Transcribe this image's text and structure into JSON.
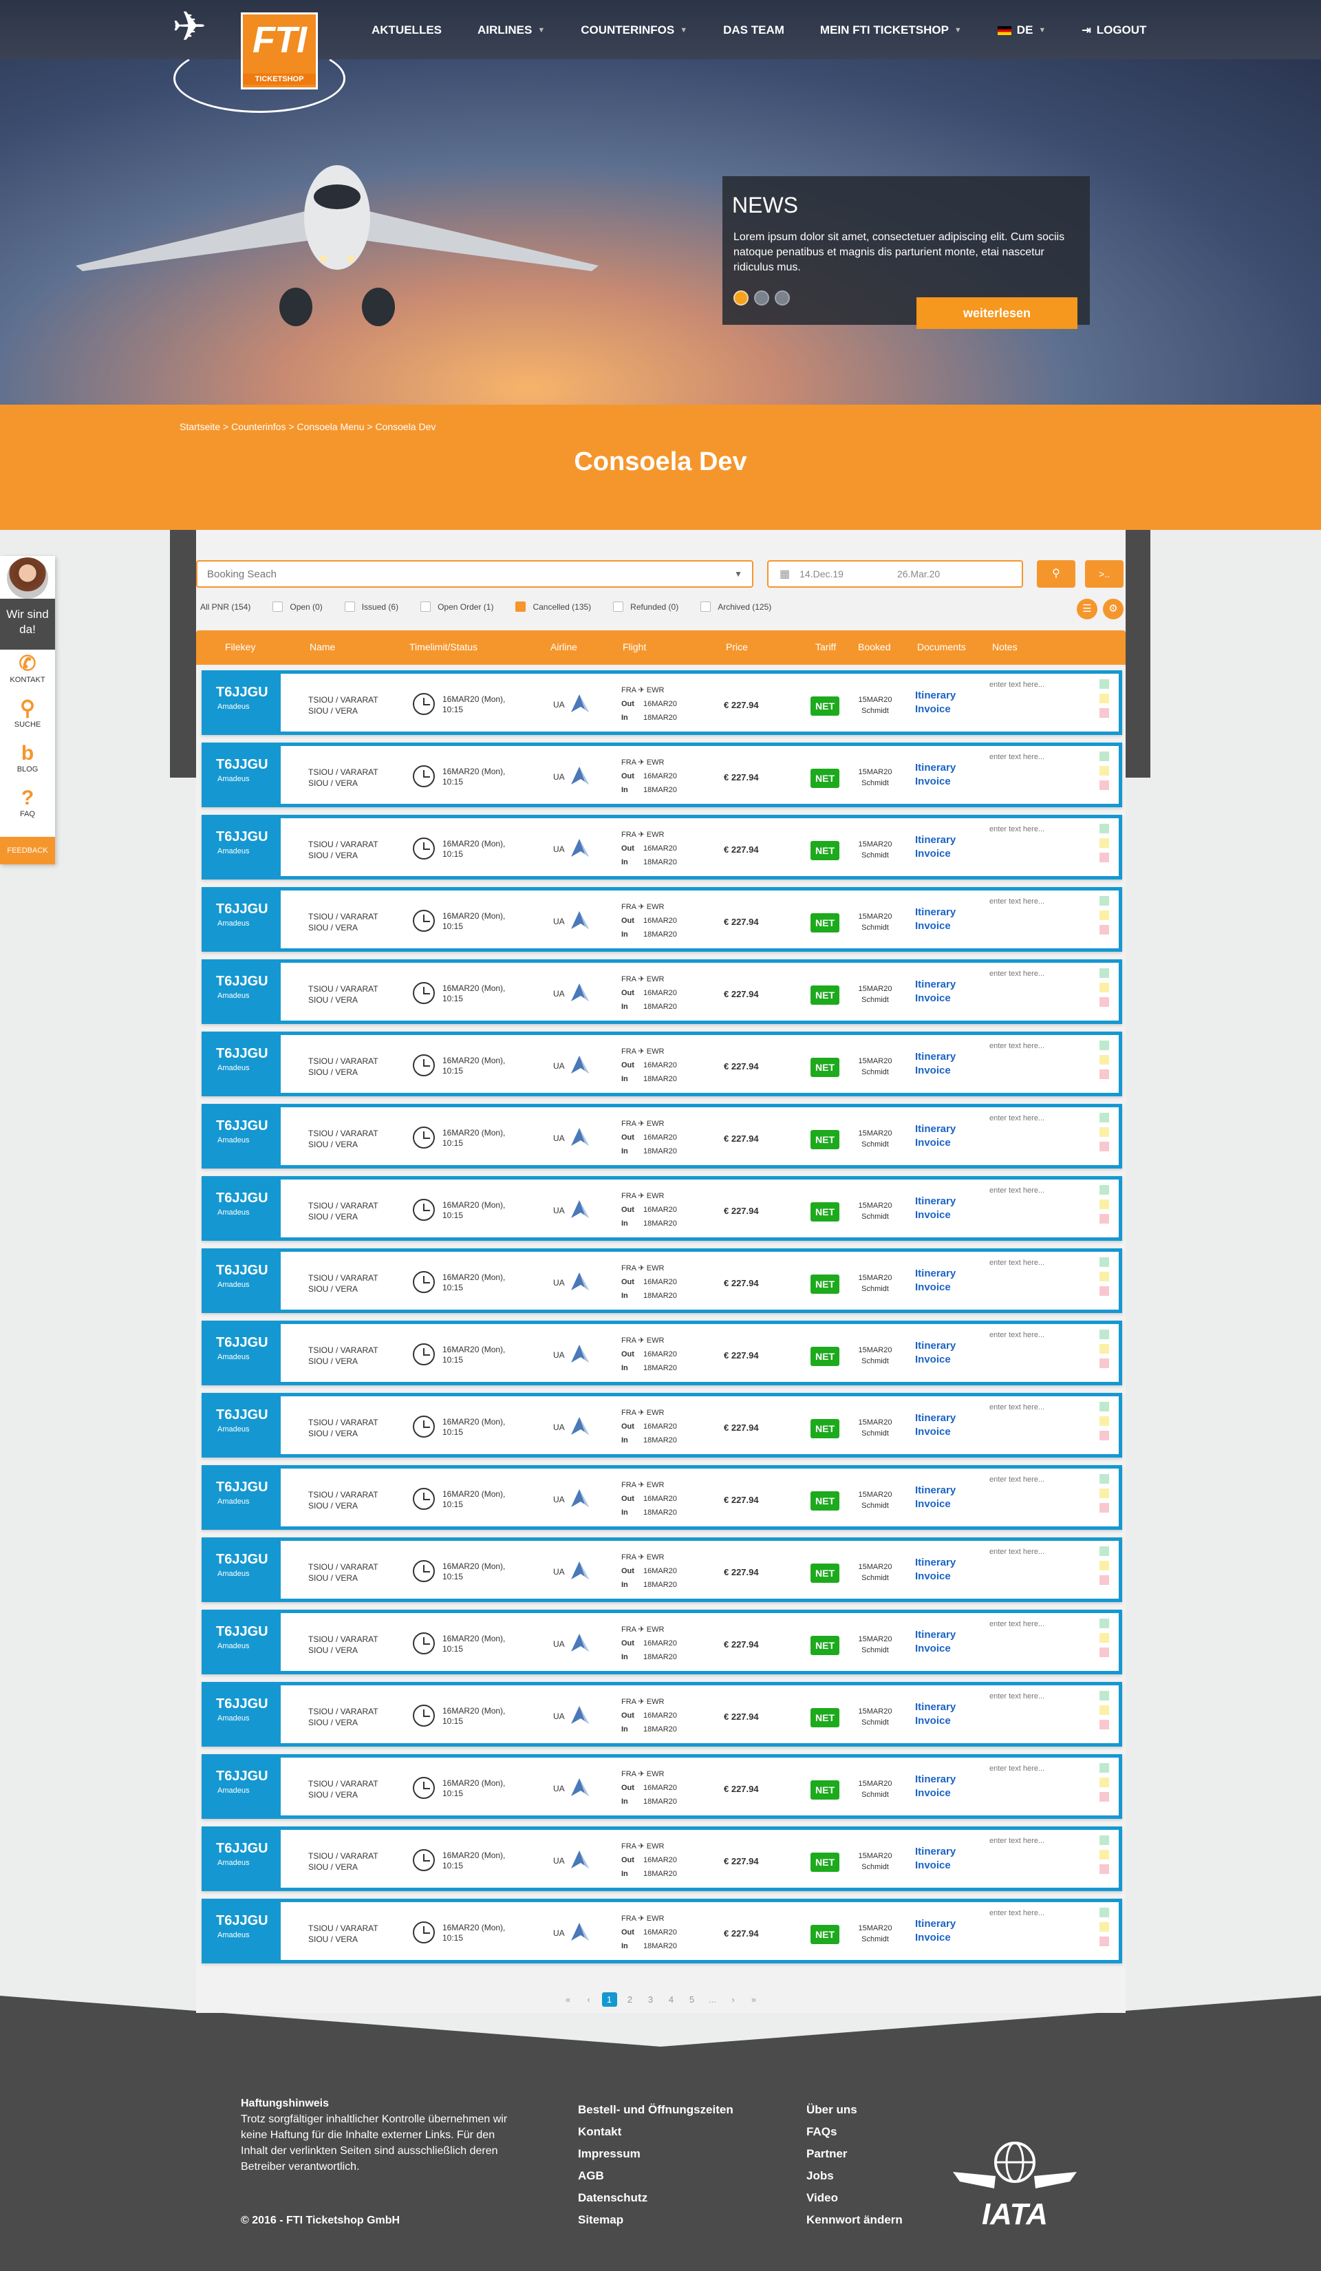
{
  "brand": {
    "logo_text": "FTI",
    "logo_sub": "TICKETSHOP"
  },
  "nav": {
    "items": [
      {
        "label": "AKTUELLES",
        "dropdown": false
      },
      {
        "label": "AIRLINES",
        "dropdown": true
      },
      {
        "label": "COUNTERINFOS",
        "dropdown": true
      },
      {
        "label": "DAS TEAM",
        "dropdown": false
      },
      {
        "label": "MEIN FTI TICKETSHOP",
        "dropdown": true
      }
    ],
    "language": "DE",
    "logout": "LOGOUT"
  },
  "news": {
    "title": "NEWS",
    "text": "Lorem ipsum dolor sit amet, consectetuer adipiscing elit. Cum sociis natoque penatibus et magnis dis parturient monte, etai nascetur ridiculus mus.",
    "button": "weiterlesen",
    "slides": 3,
    "active_slide": 1
  },
  "breadcrumb": "Startseite > Counterinfos > Consoela Menu > Consoela Dev",
  "page_title": "Consoela Dev",
  "search": {
    "placeholder": "Booking Seach",
    "date_from": "14.Dec.19",
    "date_to": "26.Mar.20",
    "next_label": ">.."
  },
  "filters": [
    {
      "label": "All PNR (154)",
      "checkbox": false,
      "checked": false
    },
    {
      "label": "Open (0)",
      "checkbox": true,
      "checked": false
    },
    {
      "label": "Issued (6)",
      "checkbox": true,
      "checked": false
    },
    {
      "label": "Open Order (1)",
      "checkbox": true,
      "checked": false
    },
    {
      "label": "Cancelled (135)",
      "checkbox": true,
      "checked": true
    },
    {
      "label": "Refunded (0)",
      "checkbox": true,
      "checked": false
    },
    {
      "label": "Archived (125)",
      "checkbox": true,
      "checked": false
    }
  ],
  "table": {
    "headers": [
      "Filekey",
      "Name",
      "Timelimit/Status",
      "Airline",
      "Flight",
      "Price",
      "Tariff",
      "Booked",
      "Documents",
      "Notes"
    ],
    "rows": [
      {
        "filekey": "T6JJGU",
        "gds": "Amadeus",
        "name": "TSIOU / VARARAT SIOU / VERA",
        "timelimit": "16MAR20 (Mon), 10:15",
        "airline": "UA",
        "from": "FRA",
        "to": "EWR",
        "out": "16MAR20",
        "in": "18MAR20",
        "price": "€ 227.94",
        "tariff": "NET",
        "booked_date": "15MAR20",
        "booked_by": "Schmidt",
        "doc1": "Itinerary",
        "doc2": "Invoice",
        "notes_placeholder": "enter text here..."
      },
      {
        "filekey": "T6JJGU",
        "gds": "Amadeus",
        "name": "TSIOU / VARARAT SIOU / VERA",
        "timelimit": "16MAR20 (Mon), 10:15",
        "airline": "UA",
        "from": "FRA",
        "to": "EWR",
        "out": "16MAR20",
        "in": "18MAR20",
        "price": "€ 227.94",
        "tariff": "NET",
        "booked_date": "15MAR20",
        "booked_by": "Schmidt",
        "doc1": "Itinerary",
        "doc2": "Invoice",
        "notes_placeholder": "enter text here..."
      },
      {
        "filekey": "T6JJGU",
        "gds": "Amadeus",
        "name": "TSIOU / VARARAT SIOU / VERA",
        "timelimit": "16MAR20 (Mon), 10:15",
        "airline": "UA",
        "from": "FRA",
        "to": "EWR",
        "out": "16MAR20",
        "in": "18MAR20",
        "price": "€ 227.94",
        "tariff": "NET",
        "booked_date": "15MAR20",
        "booked_by": "Schmidt",
        "doc1": "Itinerary",
        "doc2": "Invoice",
        "notes_placeholder": "enter text here..."
      },
      {
        "filekey": "T6JJGU",
        "gds": "Amadeus",
        "name": "TSIOU / VARARAT SIOU / VERA",
        "timelimit": "16MAR20 (Mon), 10:15",
        "airline": "UA",
        "from": "FRA",
        "to": "EWR",
        "out": "16MAR20",
        "in": "18MAR20",
        "price": "€ 227.94",
        "tariff": "NET",
        "booked_date": "15MAR20",
        "booked_by": "Schmidt",
        "doc1": "Itinerary",
        "doc2": "Invoice",
        "notes_placeholder": "enter text here..."
      },
      {
        "filekey": "T6JJGU",
        "gds": "Amadeus",
        "name": "TSIOU / VARARAT SIOU / VERA",
        "timelimit": "16MAR20 (Mon), 10:15",
        "airline": "UA",
        "from": "FRA",
        "to": "EWR",
        "out": "16MAR20",
        "in": "18MAR20",
        "price": "€ 227.94",
        "tariff": "NET",
        "booked_date": "15MAR20",
        "booked_by": "Schmidt",
        "doc1": "Itinerary",
        "doc2": "Invoice",
        "notes_placeholder": "enter text here..."
      },
      {
        "filekey": "T6JJGU",
        "gds": "Amadeus",
        "name": "TSIOU / VARARAT SIOU / VERA",
        "timelimit": "16MAR20 (Mon), 10:15",
        "airline": "UA",
        "from": "FRA",
        "to": "EWR",
        "out": "16MAR20",
        "in": "18MAR20",
        "price": "€ 227.94",
        "tariff": "NET",
        "booked_date": "15MAR20",
        "booked_by": "Schmidt",
        "doc1": "Itinerary",
        "doc2": "Invoice",
        "notes_placeholder": "enter text here..."
      },
      {
        "filekey": "T6JJGU",
        "gds": "Amadeus",
        "name": "TSIOU / VARARAT SIOU / VERA",
        "timelimit": "16MAR20 (Mon), 10:15",
        "airline": "UA",
        "from": "FRA",
        "to": "EWR",
        "out": "16MAR20",
        "in": "18MAR20",
        "price": "€ 227.94",
        "tariff": "NET",
        "booked_date": "15MAR20",
        "booked_by": "Schmidt",
        "doc1": "Itinerary",
        "doc2": "Invoice",
        "notes_placeholder": "enter text here..."
      },
      {
        "filekey": "T6JJGU",
        "gds": "Amadeus",
        "name": "TSIOU / VARARAT SIOU / VERA",
        "timelimit": "16MAR20 (Mon), 10:15",
        "airline": "UA",
        "from": "FRA",
        "to": "EWR",
        "out": "16MAR20",
        "in": "18MAR20",
        "price": "€ 227.94",
        "tariff": "NET",
        "booked_date": "15MAR20",
        "booked_by": "Schmidt",
        "doc1": "Itinerary",
        "doc2": "Invoice",
        "notes_placeholder": "enter text here..."
      },
      {
        "filekey": "T6JJGU",
        "gds": "Amadeus",
        "name": "TSIOU / VARARAT SIOU / VERA",
        "timelimit": "16MAR20 (Mon), 10:15",
        "airline": "UA",
        "from": "FRA",
        "to": "EWR",
        "out": "16MAR20",
        "in": "18MAR20",
        "price": "€ 227.94",
        "tariff": "NET",
        "booked_date": "15MAR20",
        "booked_by": "Schmidt",
        "doc1": "Itinerary",
        "doc2": "Invoice",
        "notes_placeholder": "enter text here..."
      },
      {
        "filekey": "T6JJGU",
        "gds": "Amadeus",
        "name": "TSIOU / VARARAT SIOU / VERA",
        "timelimit": "16MAR20 (Mon), 10:15",
        "airline": "UA",
        "from": "FRA",
        "to": "EWR",
        "out": "16MAR20",
        "in": "18MAR20",
        "price": "€ 227.94",
        "tariff": "NET",
        "booked_date": "15MAR20",
        "booked_by": "Schmidt",
        "doc1": "Itinerary",
        "doc2": "Invoice",
        "notes_placeholder": "enter text here..."
      },
      {
        "filekey": "T6JJGU",
        "gds": "Amadeus",
        "name": "TSIOU / VARARAT SIOU / VERA",
        "timelimit": "16MAR20 (Mon), 10:15",
        "airline": "UA",
        "from": "FRA",
        "to": "EWR",
        "out": "16MAR20",
        "in": "18MAR20",
        "price": "€ 227.94",
        "tariff": "NET",
        "booked_date": "15MAR20",
        "booked_by": "Schmidt",
        "doc1": "Itinerary",
        "doc2": "Invoice",
        "notes_placeholder": "enter text here..."
      },
      {
        "filekey": "T6JJGU",
        "gds": "Amadeus",
        "name": "TSIOU / VARARAT SIOU / VERA",
        "timelimit": "16MAR20 (Mon), 10:15",
        "airline": "UA",
        "from": "FRA",
        "to": "EWR",
        "out": "16MAR20",
        "in": "18MAR20",
        "price": "€ 227.94",
        "tariff": "NET",
        "booked_date": "15MAR20",
        "booked_by": "Schmidt",
        "doc1": "Itinerary",
        "doc2": "Invoice",
        "notes_placeholder": "enter text here..."
      },
      {
        "filekey": "T6JJGU",
        "gds": "Amadeus",
        "name": "TSIOU / VARARAT SIOU / VERA",
        "timelimit": "16MAR20 (Mon), 10:15",
        "airline": "UA",
        "from": "FRA",
        "to": "EWR",
        "out": "16MAR20",
        "in": "18MAR20",
        "price": "€ 227.94",
        "tariff": "NET",
        "booked_date": "15MAR20",
        "booked_by": "Schmidt",
        "doc1": "Itinerary",
        "doc2": "Invoice",
        "notes_placeholder": "enter text here..."
      },
      {
        "filekey": "T6JJGU",
        "gds": "Amadeus",
        "name": "TSIOU / VARARAT SIOU / VERA",
        "timelimit": "16MAR20 (Mon), 10:15",
        "airline": "UA",
        "from": "FRA",
        "to": "EWR",
        "out": "16MAR20",
        "in": "18MAR20",
        "price": "€ 227.94",
        "tariff": "NET",
        "booked_date": "15MAR20",
        "booked_by": "Schmidt",
        "doc1": "Itinerary",
        "doc2": "Invoice",
        "notes_placeholder": "enter text here..."
      },
      {
        "filekey": "T6JJGU",
        "gds": "Amadeus",
        "name": "TSIOU / VARARAT SIOU / VERA",
        "timelimit": "16MAR20 (Mon), 10:15",
        "airline": "UA",
        "from": "FRA",
        "to": "EWR",
        "out": "16MAR20",
        "in": "18MAR20",
        "price": "€ 227.94",
        "tariff": "NET",
        "booked_date": "15MAR20",
        "booked_by": "Schmidt",
        "doc1": "Itinerary",
        "doc2": "Invoice",
        "notes_placeholder": "enter text here..."
      },
      {
        "filekey": "T6JJGU",
        "gds": "Amadeus",
        "name": "TSIOU / VARARAT SIOU / VERA",
        "timelimit": "16MAR20 (Mon), 10:15",
        "airline": "UA",
        "from": "FRA",
        "to": "EWR",
        "out": "16MAR20",
        "in": "18MAR20",
        "price": "€ 227.94",
        "tariff": "NET",
        "booked_date": "15MAR20",
        "booked_by": "Schmidt",
        "doc1": "Itinerary",
        "doc2": "Invoice",
        "notes_placeholder": "enter text here..."
      },
      {
        "filekey": "T6JJGU",
        "gds": "Amadeus",
        "name": "TSIOU / VARARAT SIOU / VERA",
        "timelimit": "16MAR20 (Mon), 10:15",
        "airline": "UA",
        "from": "FRA",
        "to": "EWR",
        "out": "16MAR20",
        "in": "18MAR20",
        "price": "€ 227.94",
        "tariff": "NET",
        "booked_date": "15MAR20",
        "booked_by": "Schmidt",
        "doc1": "Itinerary",
        "doc2": "Invoice",
        "notes_placeholder": "enter text here..."
      },
      {
        "filekey": "T6JJGU",
        "gds": "Amadeus",
        "name": "TSIOU / VARARAT SIOU / VERA",
        "timelimit": "16MAR20 (Mon), 10:15",
        "airline": "UA",
        "from": "FRA",
        "to": "EWR",
        "out": "16MAR20",
        "in": "18MAR20",
        "price": "€ 227.94",
        "tariff": "NET",
        "booked_date": "15MAR20",
        "booked_by": "Schmidt",
        "doc1": "Itinerary",
        "doc2": "Invoice",
        "notes_placeholder": "enter text here..."
      }
    ],
    "tag_colors": [
      "#bfe9cf",
      "#fbf0a6",
      "#f9c7cf"
    ]
  },
  "pagination": {
    "first": "«",
    "prev": "‹",
    "pages": [
      "1",
      "2",
      "3",
      "4",
      "5"
    ],
    "ellipsis": "...",
    "next": "›",
    "last": "»",
    "active": "1"
  },
  "side_widget": {
    "wir_sind_da": "Wir sind da!",
    "kontakt": "KONTAKT",
    "suche": "SUCHE",
    "blog": "BLOG",
    "faq": "FAQ",
    "feedback": "FEEDBACK"
  },
  "footer": {
    "disclaimer_title": "Haftungshinweis",
    "disclaimer_text": "Trotz sorgfältiger inhaltlicher Kontrolle übernehmen wir keine Haftung für die Inhalte externer Links. Für den Inhalt der verlinkten Seiten sind ausschließlich deren Betreiber verantwortlich.",
    "copyright": "© 2016 - FTI Ticketshop GmbH",
    "col1": [
      "Bestell- und Öffnungszeiten",
      "Kontakt",
      "Impressum",
      "AGB",
      "Datenschutz",
      "Sitemap"
    ],
    "col2": [
      "Über uns",
      "FAQs",
      "Partner",
      "Jobs",
      "Video",
      "Kennwort ändern"
    ],
    "iata": "IATA"
  },
  "colors": {
    "accent": "#f5962c",
    "row_blue": "#1598d1",
    "dark": "#4b4b4c",
    "net_green": "#1daa1d",
    "link_blue": "#1a63c6"
  }
}
